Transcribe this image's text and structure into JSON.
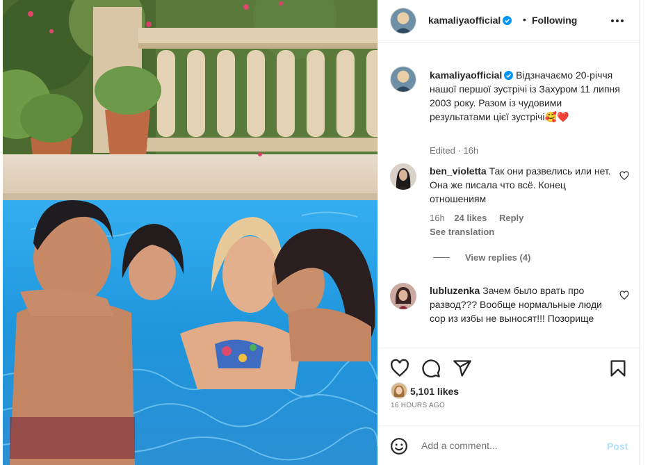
{
  "header": {
    "username": "kamaliyaofficial",
    "separator": "•",
    "follow_state": "Following"
  },
  "caption": {
    "username": "kamaliyaofficial",
    "text": "Відзначаємо 20-річчя нашої першої зустрічі із Захуром 11 липня 2003 року. Разом із чудовими результатами цієї зустрічі",
    "emoji_1": "🥰",
    "emoji_2": "❤️",
    "edited": "Edited",
    "dot": "·",
    "time": "16h"
  },
  "comments": [
    {
      "username": "ben_violetta",
      "text": "Так они развелись или нет. Она же писала что всё. Конец отношениям",
      "time": "16h",
      "likes": "24 likes",
      "reply": "Reply",
      "translation": "See translation"
    },
    {
      "username": "lubluzenka",
      "text": "Зачем было врать про развод??? Вообще нормальные люди сор из избы не выносят!!! Позорище"
    }
  ],
  "view_replies": "View replies (4)",
  "likes": "5,101 likes",
  "time_ago": "16 HOURS AGO",
  "add_comment": {
    "placeholder": "Add a comment...",
    "post_label": "Post"
  },
  "colors": {
    "verified": "#0095f6",
    "pool_water": "#2d9fe0",
    "post_disabled": "#b2dffc",
    "secondary_text": "#737373"
  },
  "icons": {
    "more": "more-horizontal-icon",
    "like": "heart-icon",
    "comment": "comment-bubble-icon",
    "share": "paper-plane-icon",
    "save": "bookmark-icon",
    "emoji": "emoji-smile-icon",
    "verified": "verified-badge-icon"
  }
}
